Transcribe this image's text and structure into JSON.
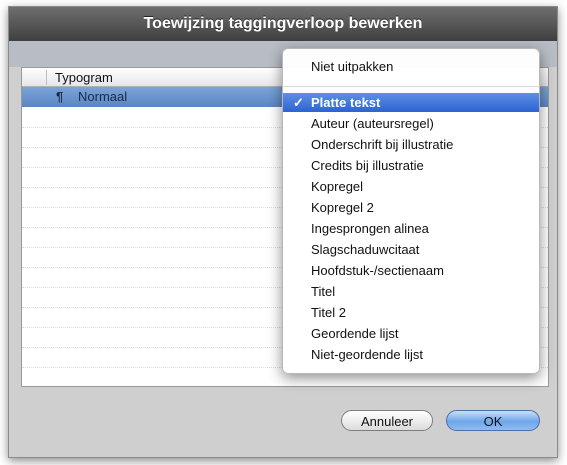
{
  "dialog": {
    "title": "Toewijzing taggingverloop bewerken"
  },
  "table": {
    "column_header": "Typogram",
    "rows": [
      {
        "label": "Normaal",
        "icon": "paragraph-style-icon",
        "selected": true
      }
    ]
  },
  "menu": {
    "top_item": "Niet uitpakken",
    "checkmark": "✓",
    "items": [
      {
        "label": "Platte tekst",
        "checked": true
      },
      {
        "label": "Auteur (auteursregel)"
      },
      {
        "label": "Onderschrift bij illustratie"
      },
      {
        "label": "Credits bij illustratie"
      },
      {
        "label": "Kopregel"
      },
      {
        "label": "Kopregel 2"
      },
      {
        "label": "Ingesprongen alinea"
      },
      {
        "label": "Slagschaduwcitaat"
      },
      {
        "label": "Hoofdstuk-/sectienaam"
      },
      {
        "label": "Titel"
      },
      {
        "label": "Titel 2"
      },
      {
        "label": "Geordende lijst"
      },
      {
        "label": "Niet-geordende lijst"
      }
    ]
  },
  "buttons": {
    "cancel_label": "Annuleer",
    "ok_label": "OK"
  },
  "colors": {
    "title_bar": "#4f4f4f",
    "selection": "#2c63d3",
    "ok_button": "#6fa6ea"
  }
}
